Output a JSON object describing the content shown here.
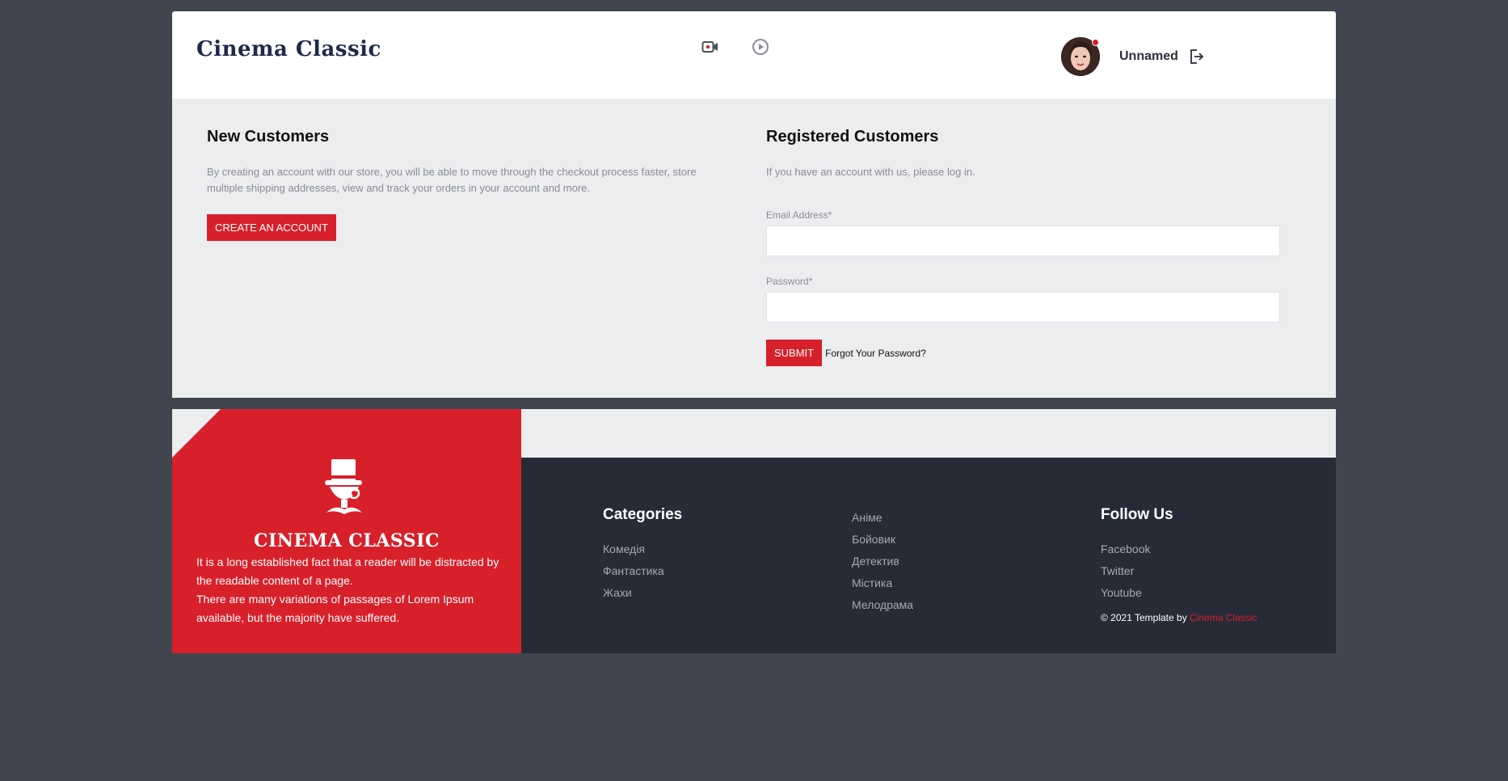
{
  "header": {
    "logo": "Cinema Classic",
    "nav_icons": [
      "video-camera-icon",
      "play-circle-icon"
    ],
    "user_name": "Unnamed"
  },
  "new_customers": {
    "title": "New Customers",
    "text": "By creating an account with our store, you will be able to move through the checkout process faster, store multiple shipping addresses, view and track your orders in your account and more.",
    "button": "CREATE AN ACCOUNT"
  },
  "registered_customers": {
    "title": "Registered Customers",
    "text": "If you have an account with us, please log in.",
    "email_label": "Email Address*",
    "email_value": "",
    "password_label": "Password*",
    "password_value": "",
    "submit": "SUBMIT",
    "forgot": "Forgot Your Password?"
  },
  "footer": {
    "brand_name": "CINEMA CLASSIC",
    "brand_text_1": "It is a long established fact that a reader will be distracted by the readable content of a page.",
    "brand_text_2": "There are many variations of passages of Lorem Ipsum available, but the majority have suffered.",
    "categories_title": "Categories",
    "categories_col1": [
      "Комедія",
      "Фантастика",
      "Жахи"
    ],
    "categories_col2": [
      "Аніме",
      "Бойовик",
      "Детектив",
      "Містика",
      "Мелодрама"
    ],
    "follow_title": "Follow Us",
    "follow_links": [
      "Facebook",
      "Twitter",
      "Youtube"
    ],
    "copyright_prefix": "© 2021 Template by ",
    "copyright_link": "Cinema Classic"
  },
  "colors": {
    "accent": "#d8202a",
    "background": "#41454f",
    "footer_dark": "#262b37",
    "section_bg": "#ecedef"
  }
}
